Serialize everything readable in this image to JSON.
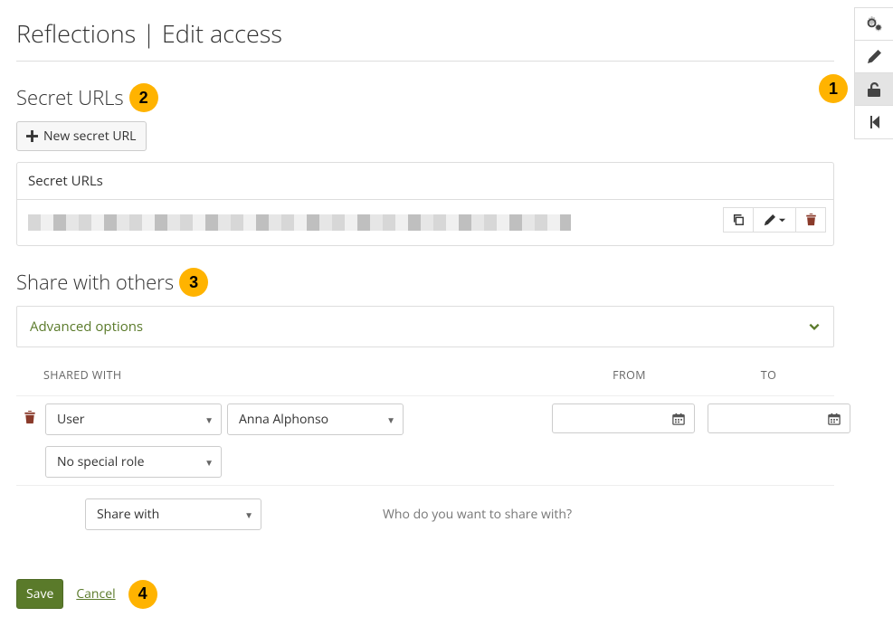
{
  "page_title": "Reflections | Edit access",
  "callouts": {
    "c1": "1",
    "c2": "2",
    "c3": "3",
    "c4": "4"
  },
  "secret_urls": {
    "heading": "Secret URLs",
    "new_button": "New secret URL",
    "panel_title": "Secret URLs"
  },
  "share": {
    "heading": "Share with others",
    "advanced_label": "Advanced options",
    "columns": {
      "who": "SHARED WITH",
      "from": "FROM",
      "to": "TO"
    },
    "row": {
      "type": "User",
      "person": "Anna Alphonso",
      "role": "No special role",
      "from": "",
      "to": ""
    },
    "add_row": {
      "sharewith_label": "Share with",
      "hint": "Who do you want to share with?"
    }
  },
  "footer": {
    "save": "Save",
    "cancel": "Cancel"
  },
  "toolbar": {
    "settings_name": "settings-icon",
    "edit_name": "pencil-icon",
    "access_name": "lock-open-icon",
    "back_name": "step-backward-icon"
  }
}
